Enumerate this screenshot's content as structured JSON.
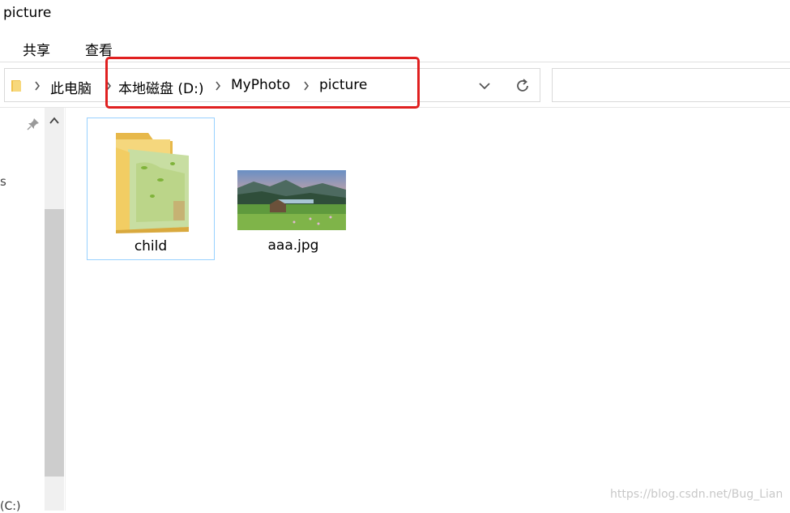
{
  "window": {
    "title": "picture"
  },
  "ribbon": {
    "tabs": [
      "共享",
      "查看"
    ]
  },
  "address_bar": {
    "crumbs": [
      "此电脑",
      "本地磁盘 (D:)",
      "MyPhoto",
      "picture"
    ]
  },
  "search": {
    "placeholder": ""
  },
  "left_pane": {
    "fragment_top": "s",
    "fragment_bottom": "(C:)"
  },
  "files": [
    {
      "name": "child",
      "type": "folder",
      "selected": true
    },
    {
      "name": "aaa.jpg",
      "type": "image",
      "selected": false
    }
  ],
  "watermark": "https://blog.csdn.net/Bug_Lian",
  "colors": {
    "highlight": "#e02020",
    "selection_border": "#99d1ff",
    "folder": "#f5cf6b"
  }
}
